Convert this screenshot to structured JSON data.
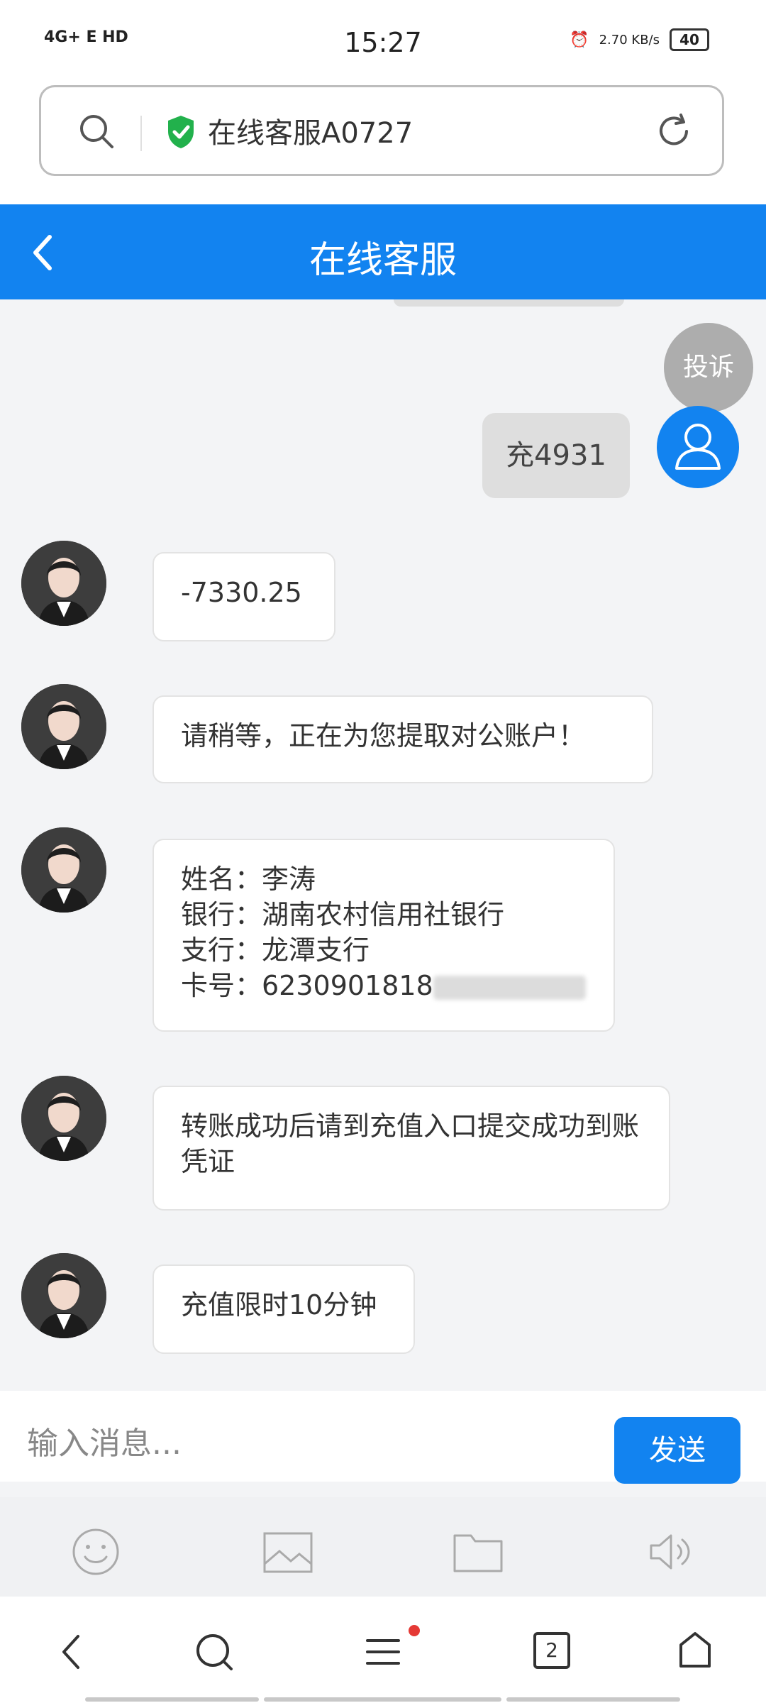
{
  "status_bar": {
    "signal": "4G+ E HD",
    "time": "15:27",
    "net_speed": "2.70 KB/s",
    "battery": "40"
  },
  "url_bar": {
    "text": "在线客服A0727"
  },
  "header": {
    "title": "在线客服"
  },
  "chat": {
    "complaint_label": "投诉",
    "user_message": "充4931",
    "agent_messages": [
      "-7330.25",
      "请稍等，正在为您提取对公账户！",
      "姓名：李涛",
      "银行：湖南农村信用社银行",
      "支行：龙潭支行",
      "卡号：6230901818",
      "转账成功后请到充值入口提交成功到账凭证",
      "充值限时10分钟"
    ]
  },
  "input": {
    "placeholder": "输入消息...",
    "send_label": "发送"
  },
  "nav": {
    "tab_count": "2"
  },
  "colors": {
    "accent": "#1283f0",
    "secure": "#22b14c",
    "notification_dot": "#e53935"
  }
}
